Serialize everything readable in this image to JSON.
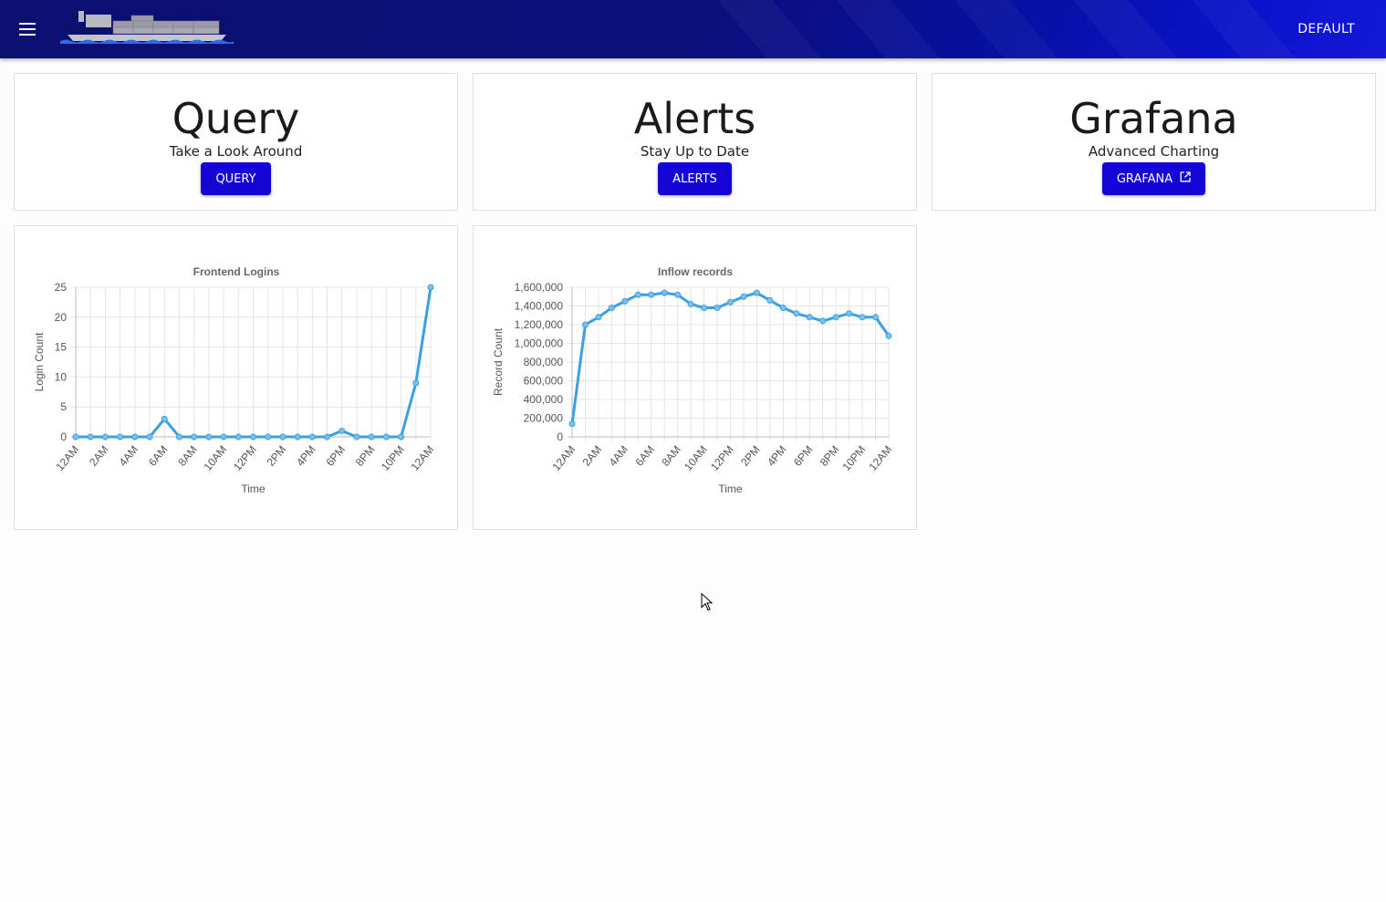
{
  "header": {
    "menu_icon": "hamburger-menu-icon",
    "logo_icon": "container-ship-logo",
    "default_label": "DEFAULT"
  },
  "cards": [
    {
      "title": "Query",
      "subtitle": "Take a Look Around",
      "button": "QUERY"
    },
    {
      "title": "Alerts",
      "subtitle": "Stay Up to Date",
      "button": "ALERTS"
    },
    {
      "title": "Grafana",
      "subtitle": "Advanced Charting",
      "button": "GRAFANA",
      "button_icon": "external-link-icon"
    }
  ],
  "colors": {
    "accent": "#1405d6",
    "line": "#3aa0e3",
    "appbar": "#0b0f6e"
  },
  "chart_data": [
    {
      "type": "line",
      "title": "Frontend Logins",
      "xlabel": "Time",
      "ylabel": "Login Count",
      "ylim": [
        0,
        25
      ],
      "yticks": [
        "0",
        "5",
        "10",
        "15",
        "20",
        "25"
      ],
      "xtick_labels": [
        "12AM",
        "2AM",
        "4AM",
        "6AM",
        "8AM",
        "10AM",
        "12PM",
        "2PM",
        "4PM",
        "6PM",
        "8PM",
        "10PM",
        "12AM"
      ],
      "grid": true,
      "series": [
        {
          "values": [
            0,
            0,
            0,
            0,
            0,
            0,
            3,
            0,
            0,
            0,
            0,
            0,
            0,
            0,
            0,
            0,
            0,
            0,
            1,
            0,
            0,
            0,
            0,
            9,
            25
          ]
        }
      ]
    },
    {
      "type": "line",
      "title": "Inflow records",
      "xlabel": "Time",
      "ylabel": "Record Count",
      "ylim": [
        0,
        1600000
      ],
      "yticks": [
        "0",
        "200,000",
        "400,000",
        "600,000",
        "800,000",
        "1,000,000",
        "1,200,000",
        "1,400,000",
        "1,600,000"
      ],
      "xtick_labels": [
        "12AM",
        "2AM",
        "4AM",
        "6AM",
        "8AM",
        "10AM",
        "12PM",
        "2PM",
        "4PM",
        "6PM",
        "8PM",
        "10PM",
        "12AM"
      ],
      "grid": true,
      "series": [
        {
          "values": [
            140000,
            1200000,
            1280000,
            1380000,
            1450000,
            1520000,
            1520000,
            1540000,
            1520000,
            1420000,
            1380000,
            1380000,
            1440000,
            1500000,
            1540000,
            1460000,
            1380000,
            1320000,
            1280000,
            1240000,
            1280000,
            1320000,
            1280000,
            1280000,
            1080000
          ]
        }
      ]
    }
  ]
}
